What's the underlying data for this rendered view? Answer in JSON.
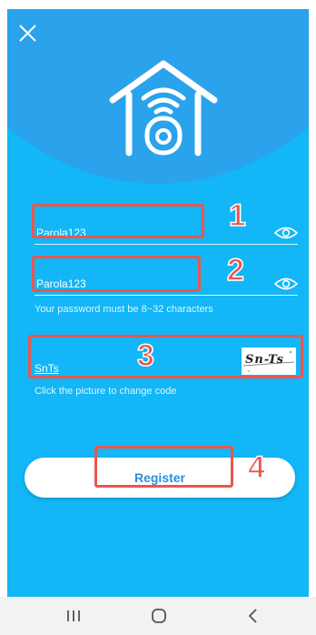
{
  "close_icon": "close-icon",
  "logo_icon": "home-wifi-camera-icon",
  "form": {
    "password_value": "Parola123",
    "confirm_password_value": "Parola123",
    "password_hint": "Your password must be 8~32 characters",
    "captcha_value": "SnTs",
    "captcha_image_text": "Sn-Ts",
    "captcha_hint": "Click the picture to change code",
    "register_label": "Register"
  },
  "annotations": {
    "n1": "1",
    "n2": "2",
    "n3": "3",
    "n4": "4"
  },
  "navbar": {
    "recent_icon": "recent-apps-icon",
    "home_icon": "home-icon",
    "back_icon": "back-icon"
  },
  "colors": {
    "background": "#13b6f6",
    "header": "#2aa2ec",
    "annotation": "#e8574f",
    "button_text": "#2a8fd8"
  }
}
